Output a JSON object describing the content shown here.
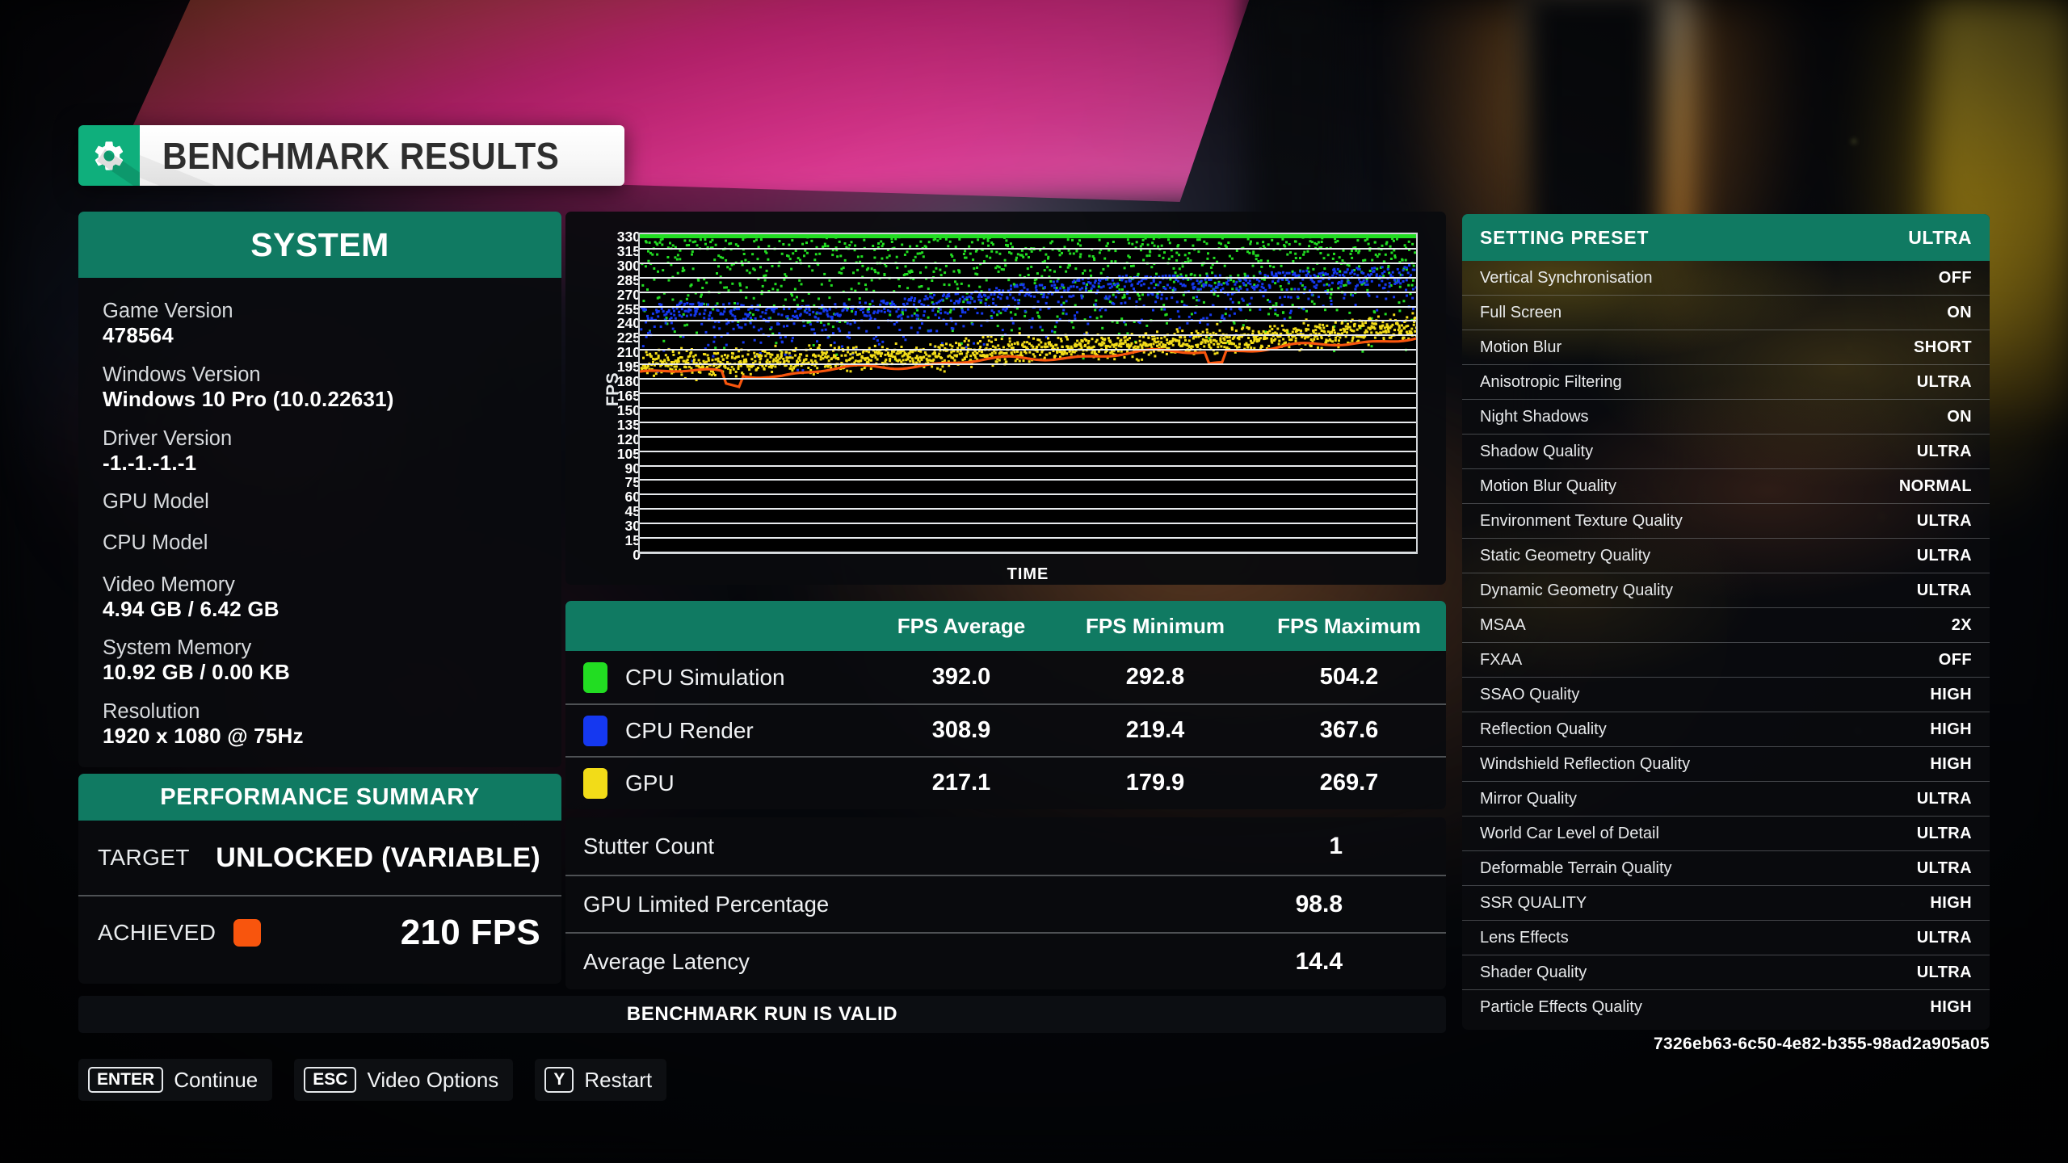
{
  "header": {
    "title": "BENCHMARK RESULTS",
    "gear_icon": "gear-icon"
  },
  "system": {
    "heading": "SYSTEM",
    "rows": [
      {
        "label": "Game Version",
        "value": "478564"
      },
      {
        "label": "Windows Version",
        "value": "Windows 10 Pro (10.0.22631)"
      },
      {
        "label": "Driver Version",
        "value": "-1.-1.-1.-1"
      },
      {
        "label": "GPU Model",
        "value": ""
      },
      {
        "label": "CPU Model",
        "value": ""
      },
      {
        "label": "Video Memory",
        "value": "4.94 GB / 6.42 GB"
      },
      {
        "label": "System Memory",
        "value": "10.92 GB / 0.00 KB"
      },
      {
        "label": "Resolution",
        "value": "1920 x 1080 @ 75Hz"
      }
    ]
  },
  "performance_summary": {
    "heading": "PERFORMANCE SUMMARY",
    "target_label": "TARGET",
    "target_value": "UNLOCKED (VARIABLE)",
    "achieved_label": "ACHIEVED",
    "achieved_value": "210 FPS",
    "achieved_swatch_color": "#f8550d"
  },
  "chart_data": {
    "type": "scatter",
    "title": "",
    "xlabel": "TIME",
    "ylabel": "FPS",
    "ylim": [
      0,
      330
    ],
    "yticks": [
      330,
      315,
      300,
      285,
      270,
      255,
      240,
      225,
      210,
      195,
      180,
      165,
      150,
      135,
      120,
      105,
      90,
      75,
      60,
      45,
      30,
      15,
      0
    ],
    "grid": true,
    "legend": "none",
    "series": [
      {
        "name": "CPU Simulation",
        "color": "#22dd22",
        "mean": 392.0,
        "min": 292.8,
        "max": 504.2,
        "note": "clipped at chart top (330 FPS ceiling)",
        "trend": [
          330,
          330,
          330,
          330,
          330,
          330,
          330,
          330,
          330,
          330,
          330,
          330
        ]
      },
      {
        "name": "CPU Render",
        "color": "#1538f0",
        "mean": 308.9,
        "min": 219.4,
        "max": 367.6,
        "trend": [
          258,
          262,
          255,
          260,
          268,
          276,
          284,
          290,
          288,
          292,
          296,
          300
        ]
      },
      {
        "name": "GPU",
        "color": "#f2dc18",
        "mean": 217.1,
        "min": 179.9,
        "max": 269.7,
        "trend": [
          196,
          198,
          200,
          203,
          206,
          210,
          214,
          216,
          220,
          224,
          230,
          236
        ]
      },
      {
        "name": "Achieved FPS",
        "color": "#f8550d",
        "style": "line",
        "trend": [
          186,
          188,
          183,
          191,
          195,
          199,
          203,
          206,
          209,
          212,
          216,
          224
        ]
      }
    ]
  },
  "fps_table": {
    "columns": [
      "",
      "FPS Average",
      "FPS Minimum",
      "FPS Maximum"
    ],
    "rows": [
      {
        "swatch": "#22dd22",
        "name": "CPU Simulation",
        "average": "392.0",
        "minimum": "292.8",
        "maximum": "504.2"
      },
      {
        "swatch": "#1538f0",
        "name": "CPU Render",
        "average": "308.9",
        "minimum": "219.4",
        "maximum": "367.6"
      },
      {
        "swatch": "#f2dc18",
        "name": "GPU",
        "average": "217.1",
        "minimum": "179.9",
        "maximum": "269.7"
      }
    ]
  },
  "stats": [
    {
      "label": "Stutter Count",
      "value": "1"
    },
    {
      "label": "GPU Limited Percentage",
      "value": "98.8"
    },
    {
      "label": "Average Latency",
      "value": "14.4"
    }
  ],
  "valid_message": "BENCHMARK RUN IS VALID",
  "keyhints": [
    {
      "key": "ENTER",
      "label": "Continue"
    },
    {
      "key": "ESC",
      "label": "Video Options"
    },
    {
      "key": "Y",
      "label": "Restart"
    }
  ],
  "settings": {
    "heading": "SETTING PRESET",
    "preset_value": "ULTRA",
    "rows": [
      {
        "name": "Vertical Synchronisation",
        "value": "OFF"
      },
      {
        "name": "Full Screen",
        "value": "ON"
      },
      {
        "name": "Motion Blur",
        "value": "SHORT"
      },
      {
        "name": "Anisotropic Filtering",
        "value": "ULTRA"
      },
      {
        "name": "Night Shadows",
        "value": "ON"
      },
      {
        "name": "Shadow Quality",
        "value": "ULTRA"
      },
      {
        "name": "Motion Blur Quality",
        "value": "NORMAL"
      },
      {
        "name": "Environment Texture Quality",
        "value": "ULTRA"
      },
      {
        "name": "Static Geometry Quality",
        "value": "ULTRA"
      },
      {
        "name": "Dynamic Geometry Quality",
        "value": "ULTRA"
      },
      {
        "name": "MSAA",
        "value": "2X"
      },
      {
        "name": "FXAA",
        "value": "OFF"
      },
      {
        "name": "SSAO Quality",
        "value": "HIGH"
      },
      {
        "name": "Reflection Quality",
        "value": "HIGH"
      },
      {
        "name": "Windshield Reflection Quality",
        "value": "HIGH"
      },
      {
        "name": "Mirror Quality",
        "value": "ULTRA"
      },
      {
        "name": "World Car Level of Detail",
        "value": "ULTRA"
      },
      {
        "name": "Deformable Terrain Quality",
        "value": "ULTRA"
      },
      {
        "name": "SSR QUALITY",
        "value": "HIGH"
      },
      {
        "name": "Lens Effects",
        "value": "ULTRA"
      },
      {
        "name": "Shader Quality",
        "value": "ULTRA"
      },
      {
        "name": "Particle Effects Quality",
        "value": "HIGH"
      }
    ]
  },
  "run_uuid": "7326eb63-6c50-4e82-b355-98ad2a905a05"
}
